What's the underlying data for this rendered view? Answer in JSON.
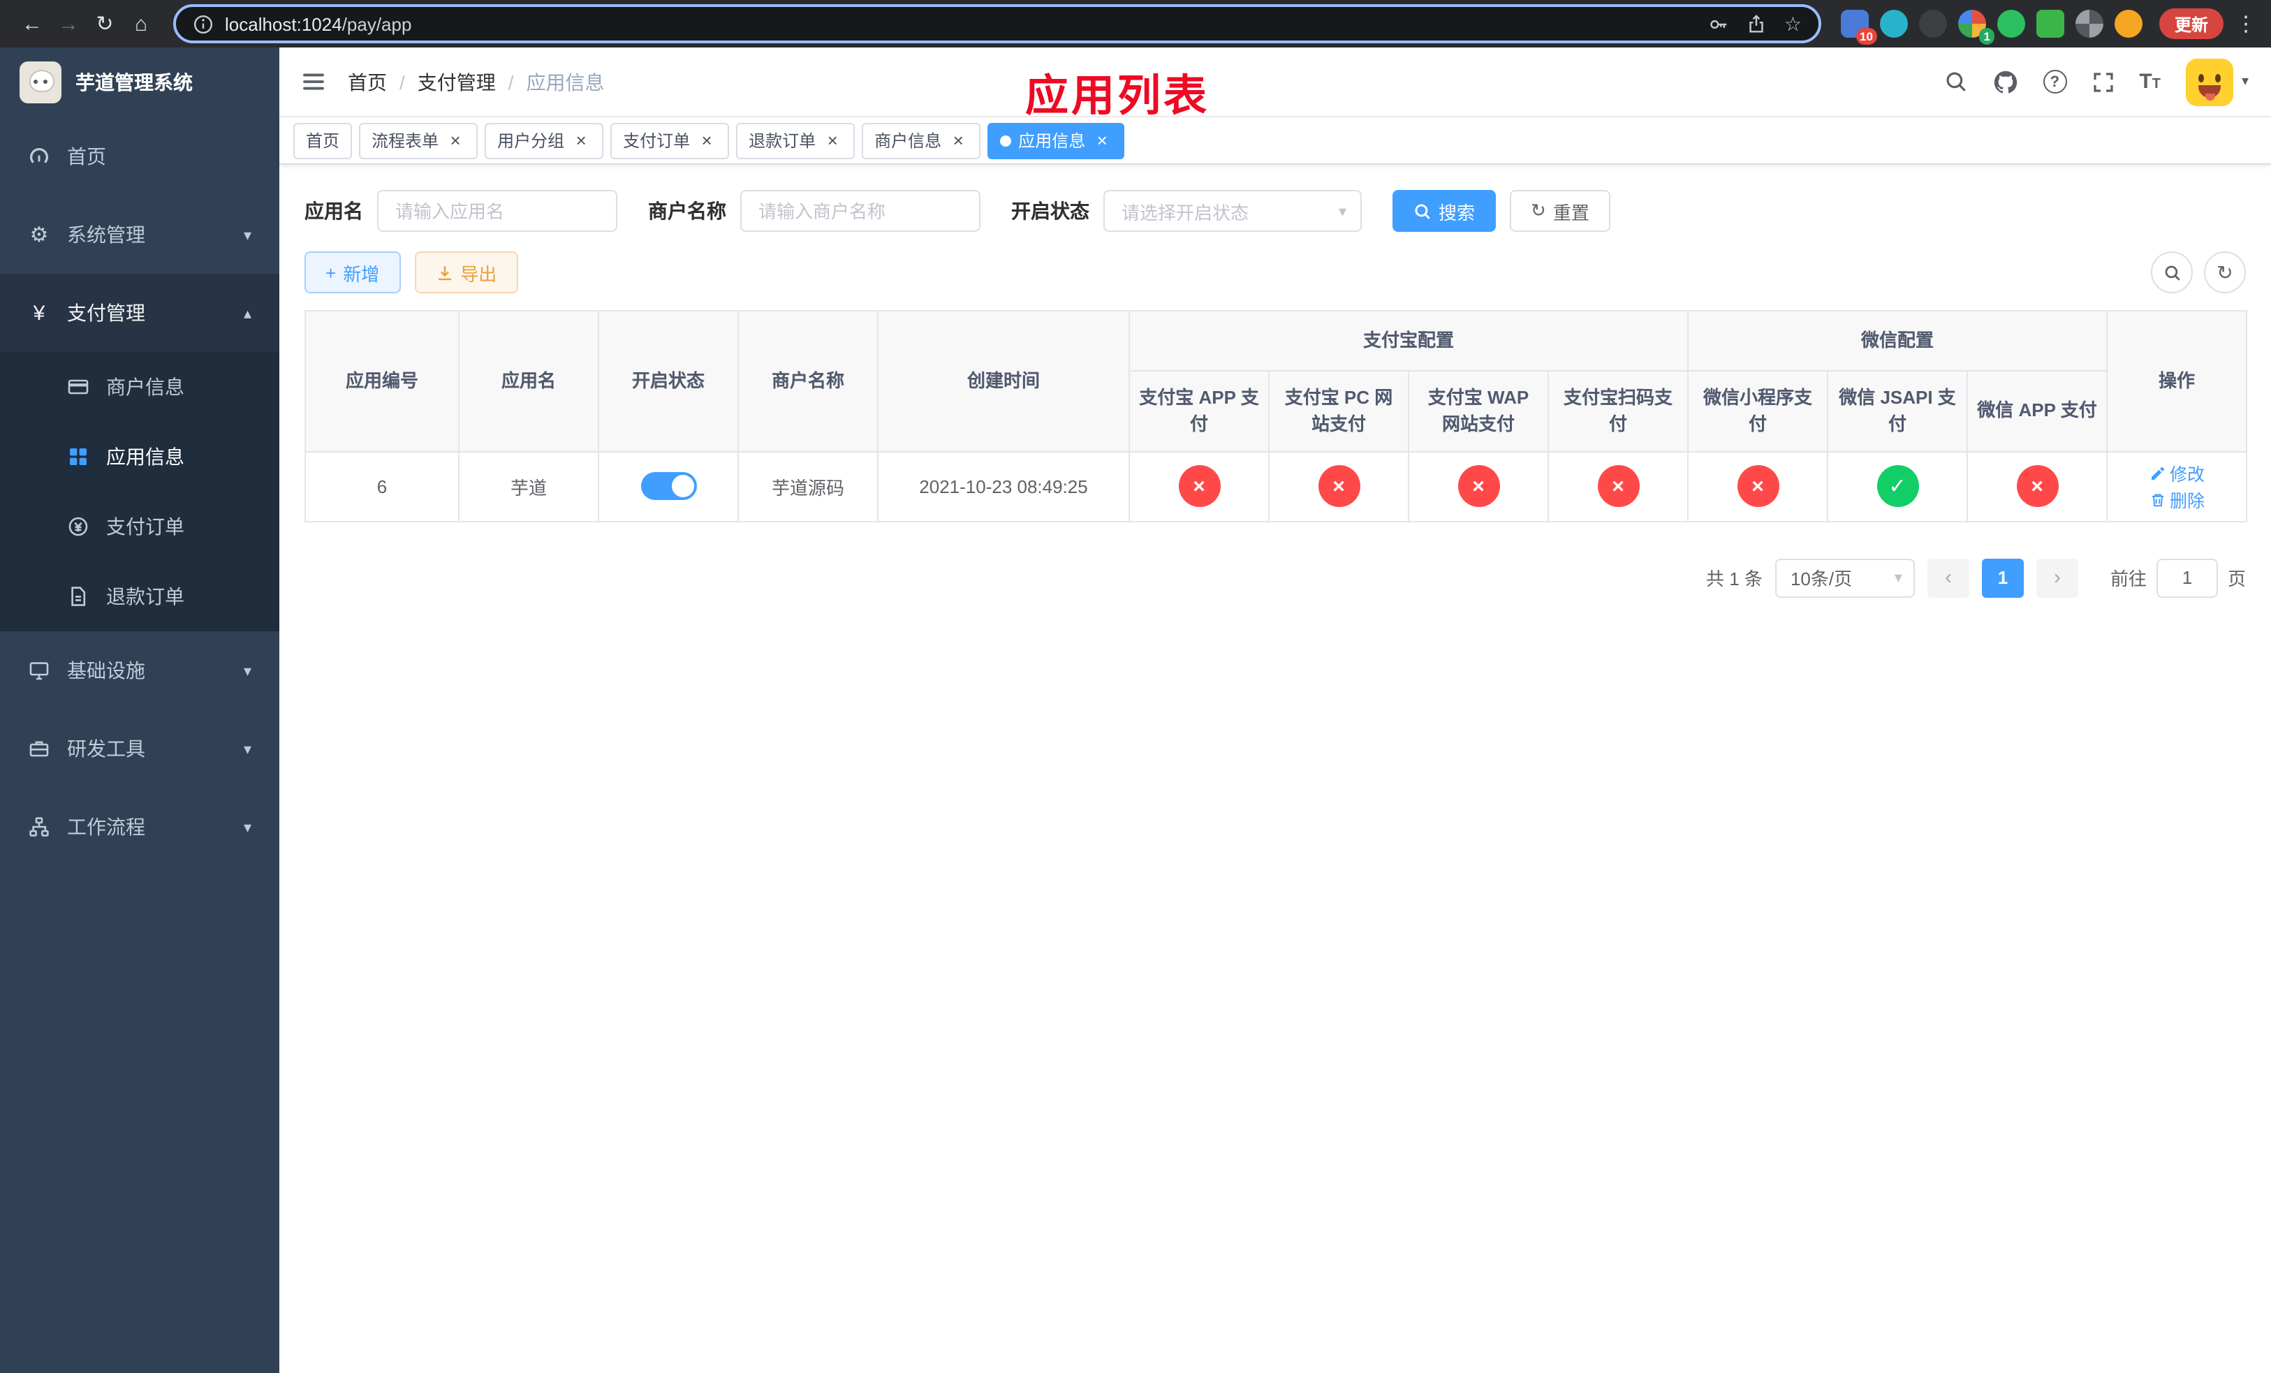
{
  "browser": {
    "url_host": "localhost:1024",
    "url_path": "/pay/app",
    "update_label": "更新",
    "extension_badges": {
      "first": "10",
      "second": "1"
    }
  },
  "icons": {
    "back": "←",
    "forward": "→",
    "reload": "↻",
    "home": "⌂",
    "star": "☆",
    "kebab": "⋮",
    "caret_down": "▾",
    "caret_up": "▴",
    "close": "×",
    "check": "✓",
    "cross": "×",
    "prev": "‹",
    "next": "›",
    "plus": "+",
    "refresh": "↻",
    "question": "?",
    "gear": "⚙",
    "yen": "¥",
    "font_large": "T",
    "font_small": "T"
  },
  "sidebar": {
    "title": "芋道管理系统",
    "items": [
      "首页",
      "系统管理",
      "支付管理",
      "商户信息",
      "应用信息",
      "支付订单",
      "退款订单",
      "基础设施",
      "研发工具",
      "工作流程"
    ]
  },
  "header": {
    "breadcrumb": [
      "首页",
      "支付管理",
      "应用信息"
    ],
    "separator": "/"
  },
  "overlay": {
    "title": "应用列表"
  },
  "tabs": [
    "首页",
    "流程表单",
    "用户分组",
    "支付订单",
    "退款订单",
    "商户信息",
    "应用信息"
  ],
  "filters": {
    "app_name_label": "应用名",
    "app_name_placeholder": "请输入应用名",
    "merchant_label": "商户名称",
    "merchant_placeholder": "请输入商户名称",
    "status_label": "开启状态",
    "status_placeholder": "请选择开启状态",
    "search_label": "搜索",
    "reset_label": "重置"
  },
  "toolbar": {
    "add_label": "新增",
    "export_label": "导出"
  },
  "table": {
    "headers": {
      "app_id": "应用编号",
      "app_name": "应用名",
      "status": "开启状态",
      "merchant": "商户名称",
      "created": "创建时间",
      "alipay_group": "支付宝配置",
      "wechat_group": "微信配置",
      "alipay_app": "支付宝 APP 支付",
      "alipay_pc": "支付宝 PC 网站支付",
      "alipay_wap": "支付宝 WAP 网站支付",
      "alipay_qr": "支付宝扫码支付",
      "wechat_lite": "微信小程序支付",
      "wechat_jsapi": "微信 JSAPI 支付",
      "wechat_app": "微信 APP 支付",
      "ops": "操作"
    },
    "rows": [
      {
        "app_id": "6",
        "app_name": "芋道",
        "status_on": true,
        "merchant": "芋道源码",
        "created": "2021-10-23 08:49:25",
        "alipay_app": "fail",
        "alipay_pc": "fail",
        "alipay_wap": "fail",
        "alipay_qr": "fail",
        "wechat_lite": "fail",
        "wechat_jsapi": "success",
        "wechat_app": "fail",
        "edit_label": "修改",
        "delete_label": "删除"
      }
    ]
  },
  "pagination": {
    "total": "共 1 条",
    "page_size": "10条/页",
    "page": "1",
    "goto_label": "前往",
    "goto_value": "1",
    "unit_label": "页"
  },
  "colors": {
    "accent": "#409EFF",
    "success": "#13ce66",
    "danger": "#ff4949",
    "warning": "#e6a23c",
    "sidebar_bg": "#304156",
    "submenu_bg": "#1f2d3d",
    "overlay_red": "#ee0a24"
  }
}
